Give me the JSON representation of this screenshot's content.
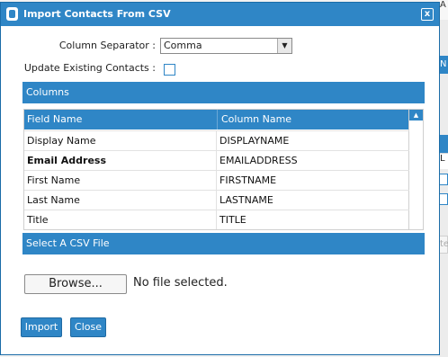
{
  "background": {
    "top_letter": "A",
    "bar_letter_1": "N",
    "bar_letter_2": "L",
    "input_text": "te"
  },
  "dialog": {
    "title": "Import Contacts From CSV",
    "close_glyph": "x",
    "column_separator": {
      "label": "Column Separator :",
      "value": "Comma",
      "arrow_glyph": "▼"
    },
    "update_existing": {
      "label": "Update Existing Contacts :",
      "checked": false
    },
    "columns_section": {
      "title": "Columns",
      "headers": {
        "field": "Field Name",
        "column": "Column Name"
      },
      "scroll_glyph": "▲",
      "rows": [
        {
          "field": "Display Name",
          "column": "DISPLAYNAME",
          "bold": false
        },
        {
          "field": "Email Address",
          "column": "EMAILADDRESS",
          "bold": true
        },
        {
          "field": "First Name",
          "column": "FIRSTNAME",
          "bold": false
        },
        {
          "field": "Last Name",
          "column": "LASTNAME",
          "bold": false
        },
        {
          "field": "Title",
          "column": "TITLE",
          "bold": false
        }
      ]
    },
    "csv_section": {
      "title": "Select A CSV File",
      "browse_label": "Browse...",
      "file_status": "No file selected."
    },
    "buttons": {
      "import_label": "Import",
      "close_label": "Close"
    }
  },
  "colors": {
    "accent": "#2f86c6",
    "accent_border": "#1a6ca8"
  }
}
